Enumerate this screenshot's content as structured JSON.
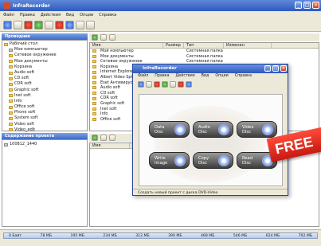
{
  "window": {
    "title": "InfraRecorder"
  },
  "menu": [
    "Файл",
    "Правка",
    "Действия",
    "Вид",
    "Опции",
    "Справка"
  ],
  "left_panel": {
    "header": "Проводник",
    "tree": [
      {
        "label": "Рабочий стол",
        "type": "folder",
        "indent": 0
      },
      {
        "label": "Мои компьютер",
        "type": "drive",
        "indent": 1
      },
      {
        "label": "Сетевое окружение",
        "type": "folder",
        "indent": 1
      },
      {
        "label": "Мои документы",
        "type": "folder",
        "indent": 1
      },
      {
        "label": "Корзина",
        "type": "folder",
        "indent": 1
      },
      {
        "label": "Audio soft",
        "type": "folder",
        "indent": 1
      },
      {
        "label": "CD soft",
        "type": "folder",
        "indent": 1
      },
      {
        "label": "CDR soft",
        "type": "folder",
        "indent": 1
      },
      {
        "label": "Graphic soft",
        "type": "folder",
        "indent": 1
      },
      {
        "label": "Inet soft",
        "type": "folder",
        "indent": 1
      },
      {
        "label": "Info",
        "type": "folder",
        "indent": 1
      },
      {
        "label": "Office soft",
        "type": "folder",
        "indent": 1
      },
      {
        "label": "Phone soft",
        "type": "folder",
        "indent": 1
      },
      {
        "label": "System soft",
        "type": "folder",
        "indent": 1
      },
      {
        "label": "Video soft",
        "type": "folder",
        "indent": 1
      },
      {
        "label": "Video_edit",
        "type": "folder",
        "indent": 1
      }
    ]
  },
  "bottom_left_panel": {
    "header": "Содержание проекта",
    "item": "100812_1440"
  },
  "right_list": {
    "columns": [
      "Имя",
      "Размер",
      "Тип",
      "Изменен"
    ],
    "rows": [
      {
        "name": "Мой компьютер",
        "size": "",
        "type": "Системная папка"
      },
      {
        "name": "Мои документы",
        "size": "",
        "type": "Системная папка"
      },
      {
        "name": "Сетевое окружение",
        "size": "",
        "type": "Системная папка"
      },
      {
        "name": "Корзина",
        "size": "",
        "type": ""
      },
      {
        "name": "Internet Explorer",
        "size": "",
        "type": ""
      },
      {
        "name": "Albert Video Splitter",
        "size": "",
        "type": ""
      },
      {
        "name": "Eset Антивирусные",
        "size": "",
        "type": ""
      },
      {
        "name": "Audio soft",
        "size": "",
        "type": ""
      },
      {
        "name": "CD soft",
        "size": "",
        "type": ""
      },
      {
        "name": "CDR soft",
        "size": "",
        "type": ""
      },
      {
        "name": "Graphic soft",
        "size": "",
        "type": ""
      },
      {
        "name": "Inet soft",
        "size": "",
        "type": ""
      },
      {
        "name": "Info",
        "size": "",
        "type": ""
      },
      {
        "name": "Office soft",
        "size": "",
        "type": ""
      }
    ]
  },
  "bottom_list": {
    "column": "Имя"
  },
  "status_scale": [
    "0 Байт",
    "78 МБ",
    "195 МБ",
    "234 МБ",
    "312 МБ",
    "390 МБ",
    "468 МБ",
    "546 МБ",
    "624 МБ",
    "702 МБ"
  ],
  "dialog": {
    "title": "InfraRecorder",
    "menu": [
      "Файл",
      "Правка",
      "Действия",
      "Вид",
      "Опции",
      "Справка"
    ],
    "buttons": [
      {
        "line1": "Data",
        "line2": "Disc"
      },
      {
        "line1": "Audio",
        "line2": "Disc"
      },
      {
        "line1": "Video",
        "line2": "Disc"
      },
      {
        "line1": "Write",
        "line2": "Image"
      },
      {
        "line1": "Copy",
        "line2": "Disc"
      },
      {
        "line1": "Read",
        "line2": "Disc"
      }
    ],
    "status": "Создать новый проект с диска DVD-Video"
  },
  "badge": "FREE",
  "colors": {
    "titlebar": "#2d5bc0",
    "badge": "#d42a1e",
    "panel": "#ece9d8"
  }
}
